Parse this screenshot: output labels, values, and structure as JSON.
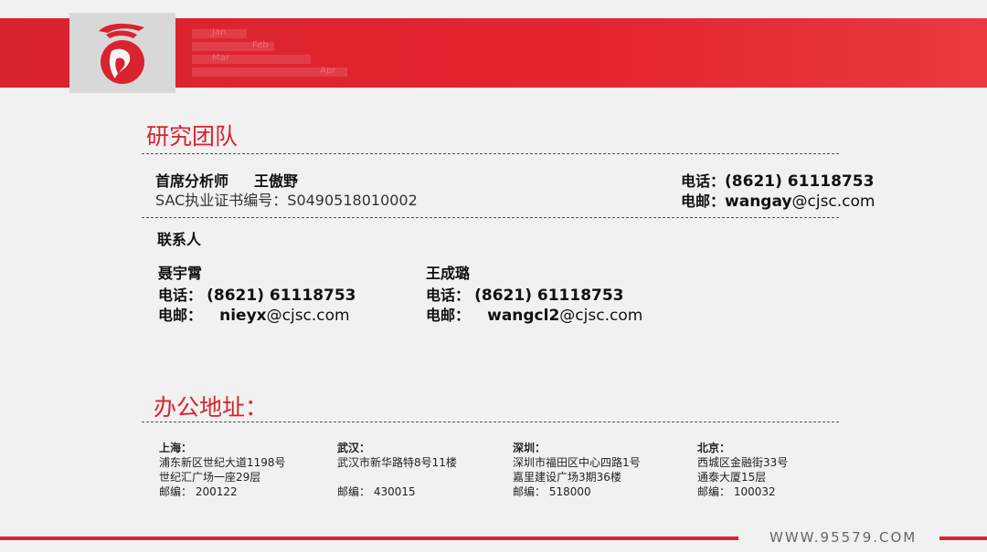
{
  "sections": {
    "team_title": "研究团队",
    "office_title": "办公地址："
  },
  "chief": {
    "role": "首席分析师",
    "name": "王傲野",
    "license": "SAC执业证书编号：S0490518010002",
    "phone_label": "电话：",
    "phone": "(8621) 61118753",
    "email_label": "电邮：",
    "email_user": "wangay",
    "email_domain": "@cjsc.com"
  },
  "contacts_title": "联系人",
  "contacts": [
    {
      "name": "聂宇霄",
      "phone_label": "电话：",
      "phone": "(8621) 61118753",
      "email_label": "电邮：",
      "email_user": "nieyx",
      "email_domain": "@cjsc.com"
    },
    {
      "name": "王成璐",
      "phone_label": "电话：",
      "phone": "(8621) 61118753",
      "email_label": "电邮：",
      "email_user": "wangcl2",
      "email_domain": "@cjsc.com"
    }
  ],
  "offices": [
    {
      "city": "上海：",
      "line1": "浦东新区世纪大道1198号",
      "line2": "世纪汇广场一座29层",
      "postcode": "邮编： 200122"
    },
    {
      "city": "武汉：",
      "line1": "武汉市新华路特8号11楼",
      "line2": "",
      "postcode": "邮编： 430015"
    },
    {
      "city": "深圳：",
      "line1": "深圳市福田区中心四路1号",
      "line2": "嘉里建设广场3期36楼",
      "postcode": "邮编： 518000"
    },
    {
      "city": "北京：",
      "line1": "西城区金融街33号",
      "line2": "通泰大厦15层",
      "postcode": "邮编： 100032"
    }
  ],
  "banner_watermark": [
    "Jan",
    "Feb",
    "Mar",
    "Apr"
  ],
  "footer": {
    "url": "WWW.95579.COM"
  },
  "colors": {
    "brand_red": "#d9232e",
    "logo_bg": "#d8d8d8"
  }
}
